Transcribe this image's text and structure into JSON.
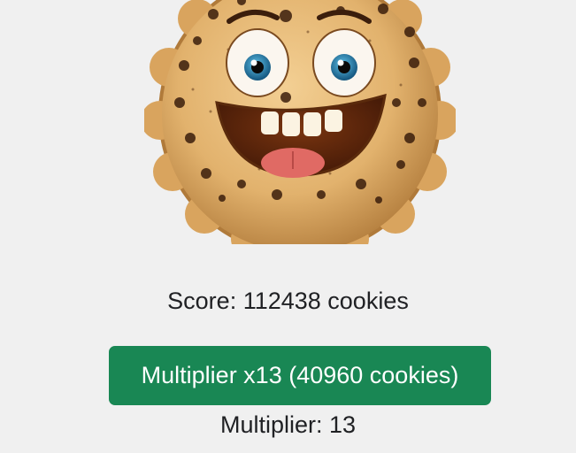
{
  "cookie": {
    "icon": "smiling-cookie-icon"
  },
  "score": {
    "label": "Score: 112438 cookies"
  },
  "multiplier_button": {
    "label": "Multiplier x13 (40960 cookies)"
  },
  "multiplier_status": {
    "label": "Multiplier: 13"
  },
  "colors": {
    "background": "#f0f0f0",
    "button": "#198754",
    "button_text": "#ffffff",
    "text": "#202124"
  }
}
